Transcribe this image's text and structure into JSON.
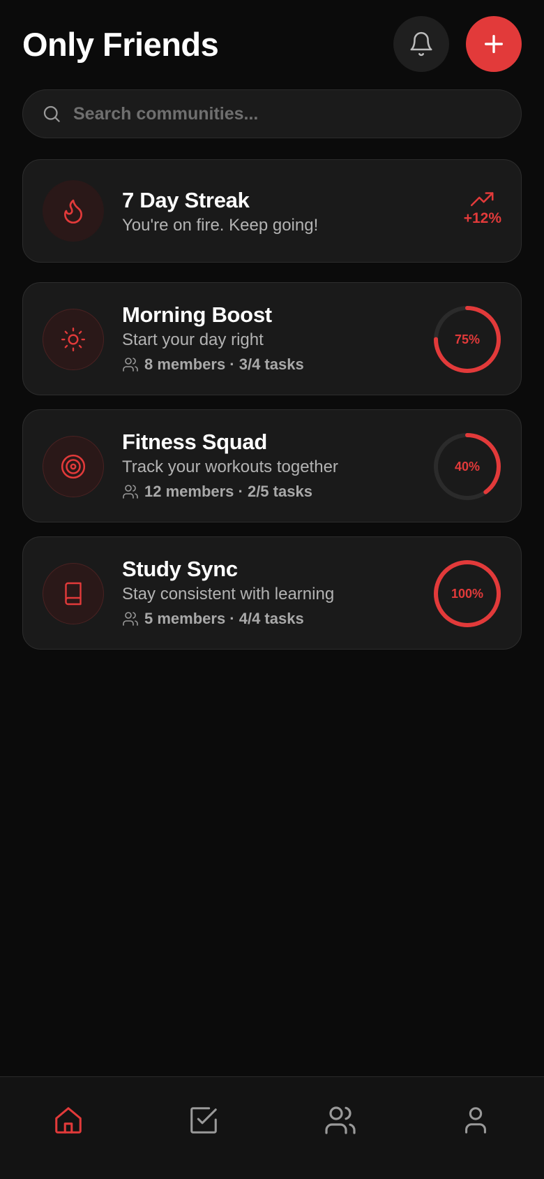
{
  "header": {
    "title": "Only Friends"
  },
  "search": {
    "placeholder": "Search communities..."
  },
  "streak": {
    "title": "7 Day Streak",
    "subtitle": "You're on fire. Keep going!",
    "trend_value": "+12%",
    "icon": "flame-icon"
  },
  "communities": [
    {
      "title": "Morning Boost",
      "subtitle": "Start your day right",
      "meta": "8 members · 3/4 tasks",
      "progress_label": "75%",
      "progress": 0.75,
      "icon": "sun-icon"
    },
    {
      "title": "Fitness Squad",
      "subtitle": "Track your workouts together",
      "meta": "12 members · 2/5 tasks",
      "progress_label": "40%",
      "progress": 0.4,
      "icon": "target-icon"
    },
    {
      "title": "Study Sync",
      "subtitle": "Stay consistent with learning",
      "meta": "5 members · 4/4 tasks",
      "progress_label": "100%",
      "progress": 1.0,
      "icon": "book-icon"
    }
  ],
  "nav": {
    "items": [
      {
        "icon": "home-icon",
        "active": true
      },
      {
        "icon": "checkbox-icon",
        "active": false
      },
      {
        "icon": "users-icon",
        "active": false
      },
      {
        "icon": "user-icon",
        "active": false
      }
    ]
  },
  "colors": {
    "accent": "#e23a3a",
    "background": "#0b0b0b",
    "card": "#1a1a1a",
    "muted": "#b3b3b3",
    "inactive_icon": "#9a9a9a"
  }
}
